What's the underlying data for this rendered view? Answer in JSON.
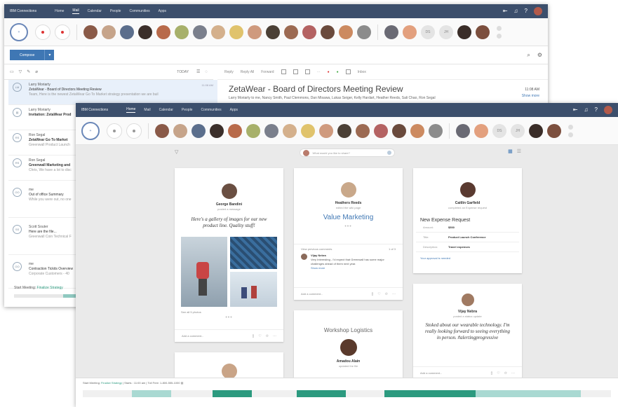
{
  "back_window": {
    "topbar": {
      "brand": "IBM Connections",
      "nav": [
        "Home",
        "Mail",
        "Calendar",
        "People",
        "Communities",
        "Apps"
      ],
      "active_nav": "Mail"
    },
    "compose_label": "Compose",
    "list_header": {
      "today": "TODAY"
    },
    "messages": [
      {
        "from": "Larry Moriarty",
        "subject": "ZetaWear - Board of Directors Meeting Review",
        "preview": "Team, Here is the newest ZetaWear Go To Market strategy presentation we are buil",
        "time": "11:08 AM",
        "icon": "LM"
      },
      {
        "from": "Larry Moriarty",
        "subject": "Invitation: ZetaWear Prod",
        "preview": "",
        "time": "",
        "icon": ""
      },
      {
        "from": "Ron Segal",
        "subject": "ZetaWear Go To Market",
        "preview": "Greenwall Product Launch",
        "time": "",
        "icon": "RS"
      },
      {
        "from": "Ron Segal",
        "subject": "Greenwall Marketing and",
        "preview": "Chris, We have a lot to disc",
        "time": "",
        "icon": "RS"
      },
      {
        "from": "me",
        "subject": "Out of office Summary",
        "preview": "While you were out, no one",
        "time": "",
        "icon": "OO"
      },
      {
        "from": "Scott Souter",
        "subject": "Here are the file...",
        "preview": "Greenwall Coin Technical F",
        "time": "",
        "icon": "SS"
      },
      {
        "from": "me",
        "subject": "Contraction Tickits Overview",
        "preview": "Corporate Customers - 40",
        "time": "",
        "icon": "OO"
      }
    ],
    "reading": {
      "actions": [
        "Reply",
        "Reply All",
        "Forward"
      ],
      "inbox": "Inbox",
      "subject": "ZetaWear - Board of Directors Meeting Review",
      "recipients": "Larry Moriarty to me, Nancy Smith, Paul Clemmons, Dan Misawa, Lukas Seiger, Kelly Hardart, Heather Reeds, Sali Chao, Ron Segal",
      "time": "11:08 AM",
      "show_more": "Show more"
    },
    "footer": {
      "label": "Start Meeting:",
      "link": "Finalize Strategy"
    }
  },
  "front_window": {
    "topbar": {
      "brand": "IBM Connections",
      "nav": [
        "Home",
        "Mail",
        "Calendar",
        "People",
        "Communities",
        "Apps"
      ],
      "active_nav": "Home"
    },
    "people_initials": [
      "DS",
      "JH"
    ],
    "search_placeholder": "What would you like to share?",
    "cards": {
      "george": {
        "name": "George Bandini",
        "action": "posted a message",
        "quote": "Here's a gallery of images for our new product line. Quality stuff!",
        "see_all": "See all 5 photos",
        "comment": "Add a comment..."
      },
      "heathers": {
        "name": "Heathers Reeds",
        "action": "edited the wiki page",
        "title": "Value Marketing",
        "view_prev": "View previous comments",
        "count": "1 of 3",
        "commenter": "Vijay Nebra",
        "comment_text": "Very Interesting - I'd expect that Greenwall has some major challenges ahead of them next year.",
        "show_more": "Show more",
        "comment": "Add a comment..."
      },
      "caitlin": {
        "name": "Caitlin Garfield",
        "action": "completed an Expense request",
        "title": "New Expense Request",
        "rows": [
          {
            "k": "Amount:",
            "v": "$500"
          },
          {
            "k": "Title:",
            "v": "Product Launch Conference"
          },
          {
            "k": "Description:",
            "v": "Travel expenses"
          }
        ],
        "link": "Your approval is needed"
      },
      "workshop": {
        "title": "Workshop Logistics",
        "name": "Amadou Alain",
        "action": "updated the file"
      },
      "vijay": {
        "name": "Vijay Nebra",
        "action": "posted a status update",
        "quote": "Stoked about our wearable technology. I'm really looking forward to seeing everything in person. #alertingprogressive",
        "comment": "Add a comment..."
      }
    },
    "bottombar": {
      "label": "Start Meeting:",
      "link": "Finalize Strategy",
      "details": "| Starts : 11:00 am | Toll Free: 1-800-555-1000"
    },
    "colors": {
      "topbar": "#3c4f6c",
      "accent": "#3f77b4",
      "timeline": "#2c9a7f"
    }
  }
}
